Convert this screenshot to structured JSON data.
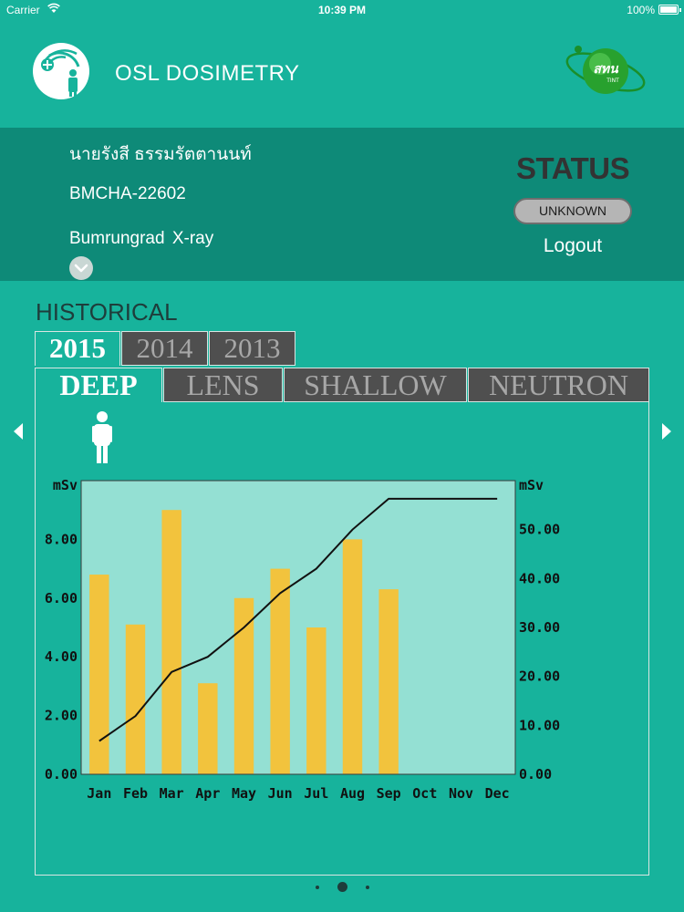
{
  "status_bar": {
    "carrier": "Carrier",
    "time": "10:39 PM",
    "battery": "100%"
  },
  "header": {
    "title": "OSL DOSIMETRY"
  },
  "user": {
    "name": "นายรังสี ธรรมรัตตานนท์",
    "id": "BMCHA-22602",
    "organization": "Bumrungrad X-ray"
  },
  "status": {
    "label": "STATUS",
    "value": "UNKNOWN",
    "logout": "Logout"
  },
  "historical": {
    "title": "HISTORICAL",
    "years": [
      "2015",
      "2014",
      "2013"
    ],
    "active_year": "2015",
    "types": [
      "DEEP",
      "LENS",
      "SHALLOW",
      "NEUTRON"
    ],
    "active_type": "DEEP"
  },
  "colors": {
    "background": "#17b39c",
    "panel": "#0e8a78",
    "bar": "#f2c33d",
    "plot_bg": "#94e0d3",
    "tab_inactive": "#4f4f4f"
  },
  "chart_data": {
    "type": "bar",
    "categories": [
      "Jan",
      "Feb",
      "Mar",
      "Apr",
      "May",
      "Jun",
      "Jul",
      "Aug",
      "Sep",
      "Oct",
      "Nov",
      "Dec"
    ],
    "ylabel_left": "mSv",
    "ylabel_right": "mSv",
    "ylim_left": [
      0,
      10
    ],
    "ylim_right": [
      0,
      60
    ],
    "yticks_left": [
      "0.00",
      "2.00",
      "4.00",
      "6.00",
      "8.00"
    ],
    "yticks_right": [
      "0.00",
      "10.00",
      "20.00",
      "30.00",
      "40.00",
      "50.00"
    ],
    "series": [
      {
        "kind": "bar",
        "axis": "left",
        "values": [
          6.8,
          5.1,
          9.0,
          3.1,
          6.0,
          7.0,
          5.0,
          8.0,
          6.3,
          0,
          0,
          0
        ]
      },
      {
        "kind": "line",
        "axis": "right",
        "values": [
          6.8,
          11.9,
          20.9,
          24.0,
          30.0,
          37.0,
          42.0,
          50.0,
          56.3,
          56.3,
          56.3,
          56.3
        ]
      }
    ]
  },
  "pager": {
    "page_count": 3,
    "current_page": 2
  }
}
